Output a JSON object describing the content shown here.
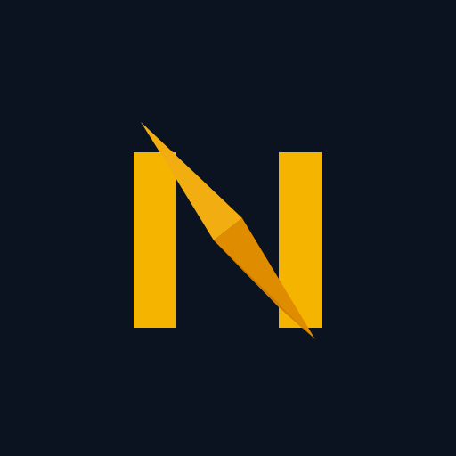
{
  "icon": {
    "name": "n-compass-logo",
    "colors": {
      "background": "#0b1220",
      "letter": "#f5b400",
      "needle_light": "#ffc83d",
      "needle_mid": "#f2ad10",
      "needle_shade": "#e08c00",
      "needle_dark": "#d37f00"
    }
  }
}
